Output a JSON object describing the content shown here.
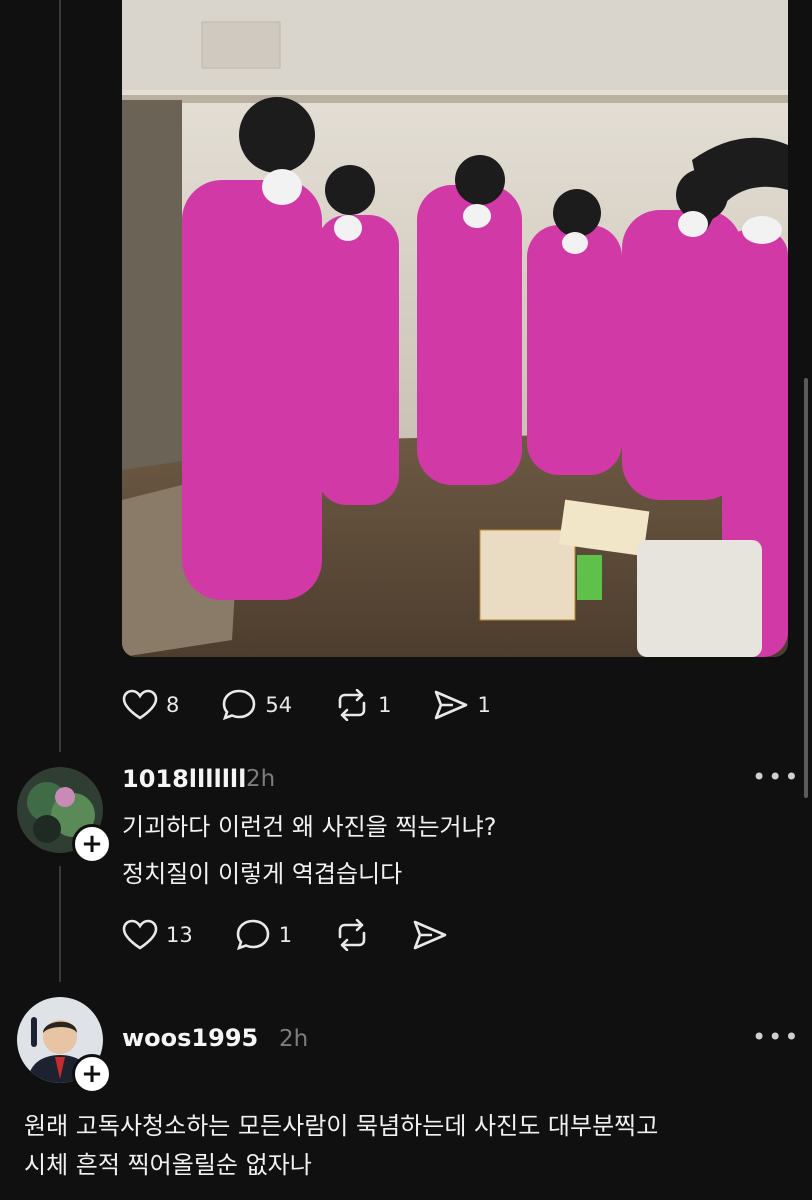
{
  "post": {
    "likes": "8",
    "comments": "54",
    "reposts": "1",
    "shares": "1"
  },
  "replies": [
    {
      "username": "1018lllllll",
      "time": "2h",
      "lines": [
        "기괴하다 이런건 왜 사진을 찍는거냐?",
        "정치질이 이렇게 역겹습니다"
      ],
      "likes": "13",
      "comments": "1"
    },
    {
      "username": "woos1995",
      "time": "2h",
      "lines": [
        "원래 고독사청소하는 모든사람이 묵념하는데 사진도 대부분찍고",
        "시체 흔적 찍어올릴순 없자나"
      ]
    }
  ],
  "icons": {
    "like": "heart-icon",
    "comment": "speech-bubble-icon",
    "repost": "repost-arrows-icon",
    "share": "paper-plane-icon",
    "more": "more-dots-icon",
    "follow": "plus-icon"
  },
  "colors": {
    "background": "#101010",
    "suit": "#d13aa6",
    "muted": "#7d7d7d"
  }
}
